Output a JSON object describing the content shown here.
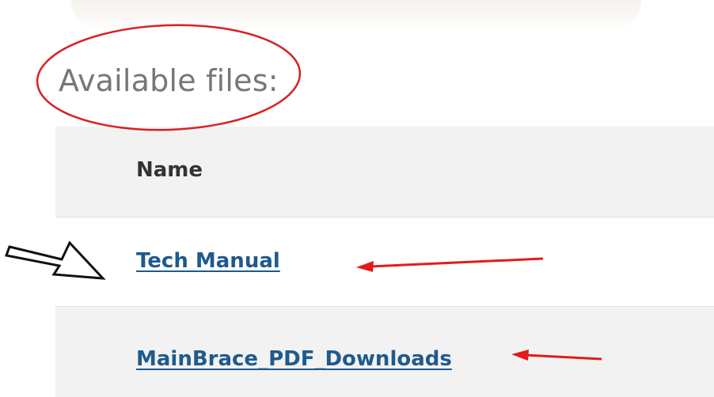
{
  "heading": "Available files:",
  "table": {
    "column_header": "Name",
    "files": [
      {
        "label": "Tech Manual"
      },
      {
        "label": "MainBrace_PDF_Downloads"
      }
    ]
  },
  "annotation_colors": {
    "circle": "#d92121",
    "arrows": "#e21b1b",
    "pointer": "#111111"
  }
}
